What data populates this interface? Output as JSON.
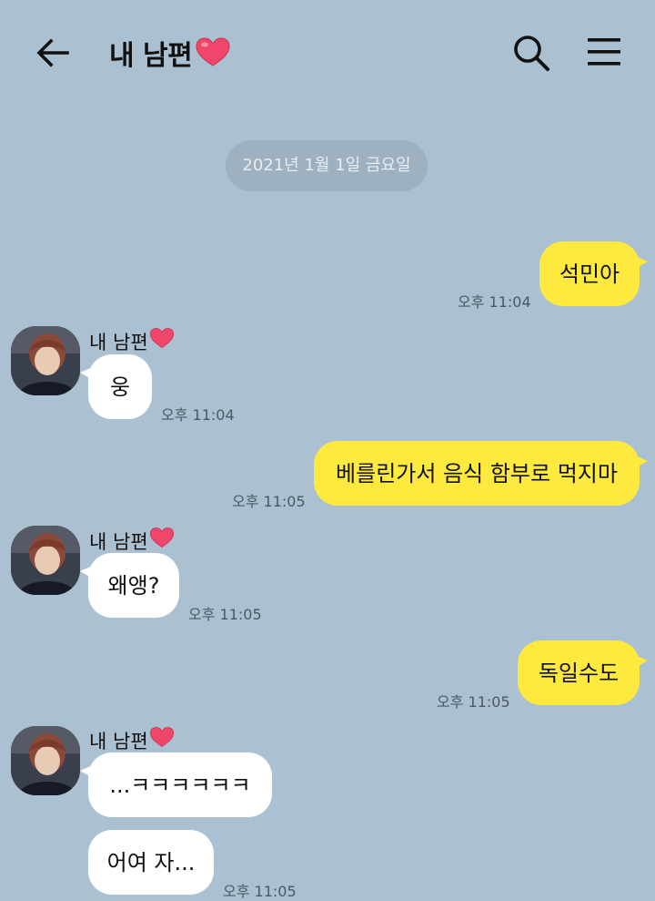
{
  "header": {
    "title": "내 남편",
    "back_icon": "arrow-left-icon",
    "search_icon": "search-icon",
    "menu_icon": "hamburger-menu-icon",
    "heart_color": "#f0466b"
  },
  "date_divider": "2021년 1월 1일 금요일",
  "sender_name": "내 남편",
  "messages": [
    {
      "from": "me",
      "text": "석민아",
      "time": "오후 11:04"
    },
    {
      "from": "them",
      "text": "웅",
      "time": "오후 11:04"
    },
    {
      "from": "me",
      "text": "베를린가서 음식 함부로 먹지마",
      "time": "오후 11:05"
    },
    {
      "from": "them",
      "text": "왜앵?",
      "time": "오후 11:05"
    },
    {
      "from": "me",
      "text": "독일수도",
      "time": "오후 11:05"
    },
    {
      "from": "them",
      "text": "...ㅋㅋㅋㅋㅋㅋ",
      "time": ""
    },
    {
      "from": "them",
      "text": "어여 자...",
      "time": "오후 11:05"
    }
  ],
  "colors": {
    "background": "#abc1d1",
    "my_bubble": "#fee93e",
    "their_bubble": "#ffffff",
    "date_pill": "#9db1c0"
  }
}
